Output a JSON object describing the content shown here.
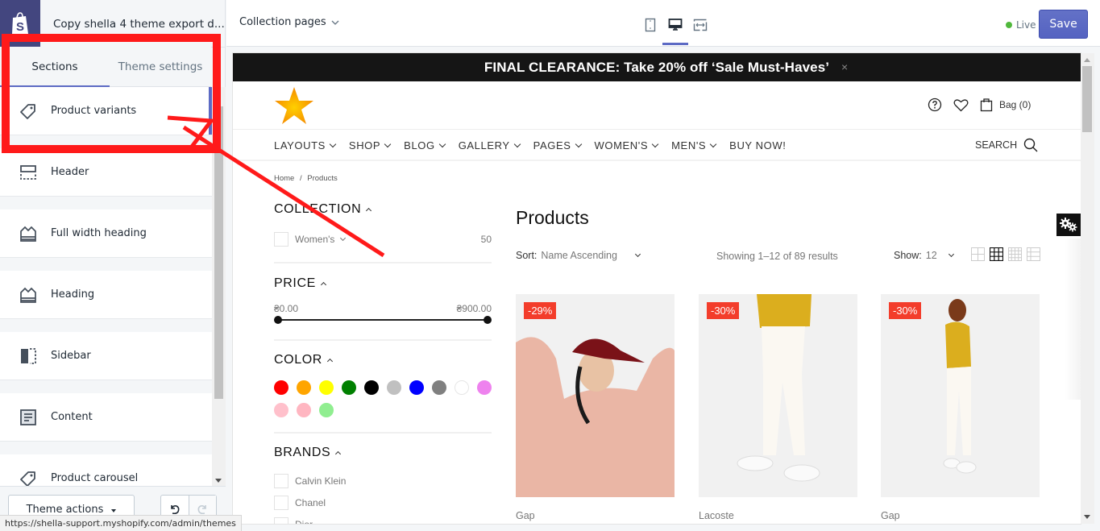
{
  "editor": {
    "theme_name": "Copy shella 4 theme export d...",
    "tabs": [
      {
        "label": "Sections",
        "active": true
      },
      {
        "label": "Theme settings",
        "active": false
      }
    ],
    "sections": [
      {
        "label": "Product variants",
        "icon": "tag-icon",
        "selected": true
      },
      {
        "label": "Header",
        "icon": "header-layout-icon"
      },
      {
        "label": "Full width heading",
        "icon": "heading-icon"
      },
      {
        "label": "Heading",
        "icon": "heading-icon"
      },
      {
        "label": "Sidebar",
        "icon": "sidebar-layout-icon"
      },
      {
        "label": "Content",
        "icon": "content-icon"
      },
      {
        "label": "Product carousel",
        "icon": "tag-icon"
      }
    ],
    "theme_actions_label": "Theme actions",
    "status_url": "https://shella-support.myshopify.com/admin/themes"
  },
  "topbar": {
    "page_select": "Collection pages",
    "devices": [
      "mobile",
      "desktop",
      "full-width"
    ],
    "active_device": "desktop",
    "live_label": "Live",
    "save_label": "Save",
    "accent": "#5c6ac4"
  },
  "store": {
    "announcement": "FINAL CLEARANCE: Take 20% off ‘Sale Must-Haves’",
    "announcement_close": "×",
    "bag_label": "Bag (0)",
    "nav": [
      {
        "label": "LAYOUTS",
        "dropdown": true
      },
      {
        "label": "SHOP",
        "dropdown": true
      },
      {
        "label": "BLOG",
        "dropdown": true
      },
      {
        "label": "GALLERY",
        "dropdown": true
      },
      {
        "label": "PAGES",
        "dropdown": true
      },
      {
        "label": "WOMEN'S",
        "dropdown": true
      },
      {
        "label": "MEN'S",
        "dropdown": true
      },
      {
        "label": "BUY NOW!",
        "dropdown": false
      }
    ],
    "search_label": "SEARCH",
    "breadcrumb": [
      "Home",
      "/",
      "Products"
    ],
    "filters": {
      "collection": {
        "title": "COLLECTION",
        "items": [
          {
            "label": "Women's",
            "count": "50"
          }
        ]
      },
      "price": {
        "title": "PRICE",
        "min": "₴0.00",
        "max": "₴900.00",
        "range_fraction": [
          0,
          1
        ]
      },
      "color": {
        "title": "COLOR",
        "swatches": [
          "#ff0000",
          "#ffa500",
          "#ffff00",
          "#008000",
          "#000000",
          "#c0c0c0",
          "#0000ff",
          "#808080",
          "#ffffff",
          "#ee82ee",
          "#ffc0cb",
          "#ffb6c1",
          "#90ee90"
        ]
      },
      "brands": {
        "title": "BRANDS",
        "items": [
          "Calvin Klein",
          "Chanel",
          "Dior"
        ]
      }
    },
    "main_title": "Products",
    "sort_label": "Sort:",
    "sort_value": "Name Ascending",
    "showing": "Showing 1–12 of 89 results",
    "show_label": "Show:",
    "show_value": "12",
    "products": [
      {
        "name": "Gap",
        "badge": "-29%"
      },
      {
        "name": "Lacoste",
        "badge": "-30%"
      },
      {
        "name": "Gap",
        "badge": "-30%"
      }
    ]
  },
  "annotation": {
    "color": "#ff1a1a",
    "target": "Product variants"
  }
}
